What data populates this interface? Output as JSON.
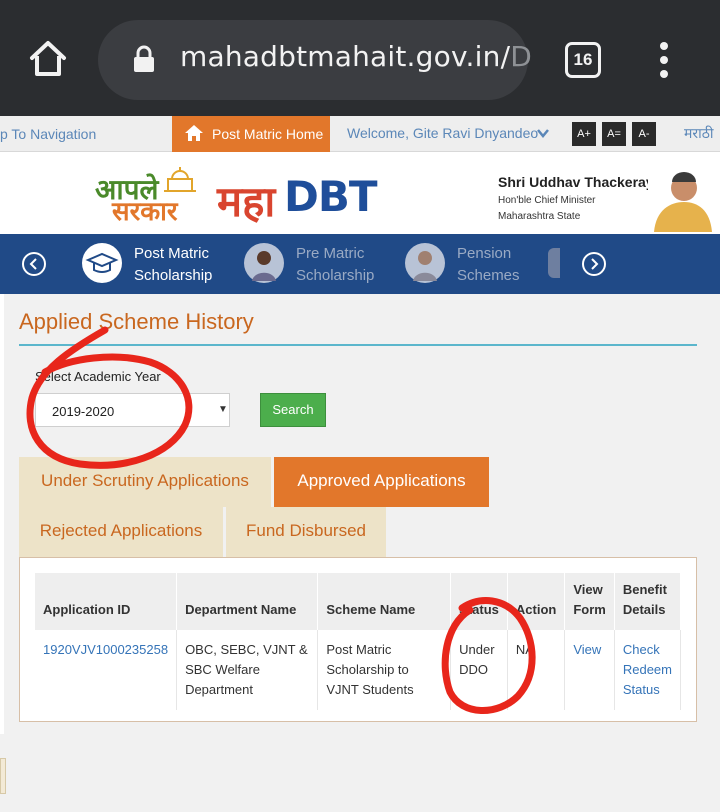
{
  "browser": {
    "url_visible": "mahadbtmahait.gov.in/",
    "url_faded": "D",
    "tab_count": "16",
    "icons": [
      "home-icon",
      "lock-icon",
      "tab-switcher-icon",
      "overflow-menu-icon"
    ]
  },
  "topbar": {
    "skip_link": "p To Navigation",
    "home_button": "Post Matric Home",
    "welcome": "Welcome, Gite Ravi Dnyandeo",
    "font_sizes": [
      "A+",
      "A=",
      "A-"
    ],
    "language": "मराठी"
  },
  "header": {
    "logo_aaple_line1": "आपले",
    "logo_aaple_line2": "सरकार",
    "logo_maha": "महा",
    "logo_dbt": "DBT",
    "cm_name": "Shri Uddhav Thackeray",
    "cm_title": "Hon'ble Chief Minister",
    "cm_state": "Maharashtra State"
  },
  "nav": {
    "items": [
      {
        "line1": "Post Matric",
        "line2": "Scholarship",
        "active": true
      },
      {
        "line1": "Pre Matric",
        "line2": "Scholarship",
        "active": false
      },
      {
        "line1": "Pension",
        "line2": "Schemes",
        "active": false
      }
    ]
  },
  "main": {
    "title": "Applied Scheme History",
    "year_label": "Select Academic Year",
    "year_value": "2019-2020",
    "search_label": "Search",
    "tabs": [
      {
        "label": "Under Scrutiny Applications",
        "active": false
      },
      {
        "label": "Approved Applications",
        "active": true
      },
      {
        "label": "Rejected Applications",
        "active": false
      },
      {
        "label": "Fund Disbursed",
        "active": false
      }
    ],
    "table": {
      "headers": [
        "Application ID",
        "Department Name",
        "Scheme Name",
        "Status",
        "Action",
        "View Form",
        "Benefit Details"
      ],
      "rows": [
        {
          "application_id": "1920VJV1000235258",
          "department": "OBC, SEBC, VJNT & SBC Welfare Department",
          "scheme": "Post Matric Scholarship to VJNT Students",
          "status": "Under DDO",
          "action": "NA",
          "view_form": "View",
          "benefit": "Check Redeem Status"
        }
      ]
    }
  },
  "colors": {
    "accent_orange": "#e2772b",
    "nav_blue": "#204a87",
    "link_blue": "#3574b8",
    "search_green": "#4cae4c",
    "annotation_red": "#e8261b"
  }
}
